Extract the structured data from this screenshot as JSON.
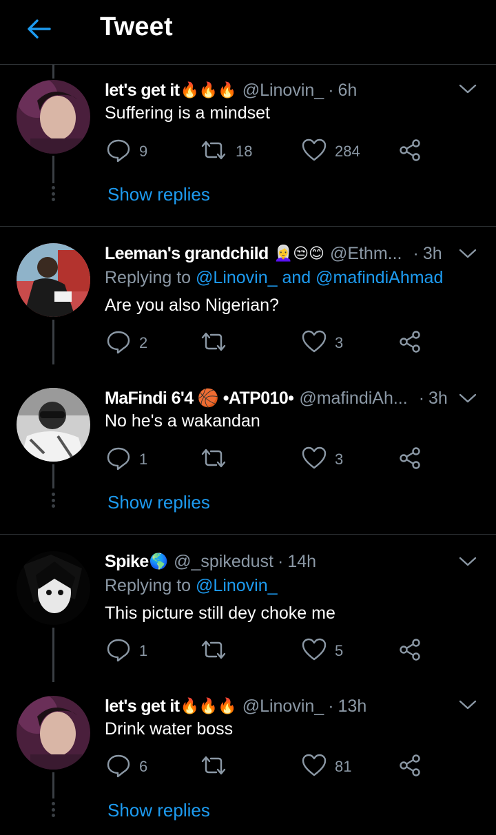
{
  "header": {
    "title": "Tweet"
  },
  "show_replies_label": "Show replies",
  "replying_label": "Replying to",
  "and_label": "and",
  "tweets": [
    {
      "name": "let's get it",
      "emojis": "🔥🔥🔥",
      "handle": "@Linovin_",
      "time": "6h",
      "text": "Suffering is a mindset",
      "replies": "9",
      "retweets": "18",
      "likes": "284"
    },
    {
      "name": "Leeman's grandchild",
      "emojis": "👩‍🦳😒😊",
      "handle": "@Ethm...",
      "time": "3h",
      "replying_to_1": "@Linovin_",
      "replying_to_2": "@mafindiAhmad",
      "text": "Are you also Nigerian?",
      "replies": "2",
      "retweets": "",
      "likes": "3"
    },
    {
      "name": "MaFindi 6'4 🏀 •ATP010•",
      "emojis": "",
      "handle": "@mafindiAh...",
      "time": "3h",
      "text": "No he's a wakandan",
      "replies": "1",
      "retweets": "",
      "likes": "3"
    },
    {
      "name": "Spike",
      "emojis": "🌎",
      "handle": "@_spikedust",
      "time": "14h",
      "replying_to_1": "@Linovin_",
      "text": "This picture still dey choke me",
      "replies": "1",
      "retweets": "",
      "likes": "5"
    },
    {
      "name": "let's get it",
      "emojis": "🔥🔥🔥",
      "handle": "@Linovin_",
      "time": "13h",
      "text": "Drink water boss",
      "replies": "6",
      "retweets": "",
      "likes": "81"
    }
  ],
  "colors": {
    "background": "#000000",
    "accent": "#1d9bf0",
    "muted": "#8b98a5",
    "divider": "#2f3336"
  },
  "icons": [
    "back-arrow-icon",
    "chevron-down-icon",
    "reply-icon",
    "retweet-icon",
    "heart-icon",
    "share-icon"
  ]
}
